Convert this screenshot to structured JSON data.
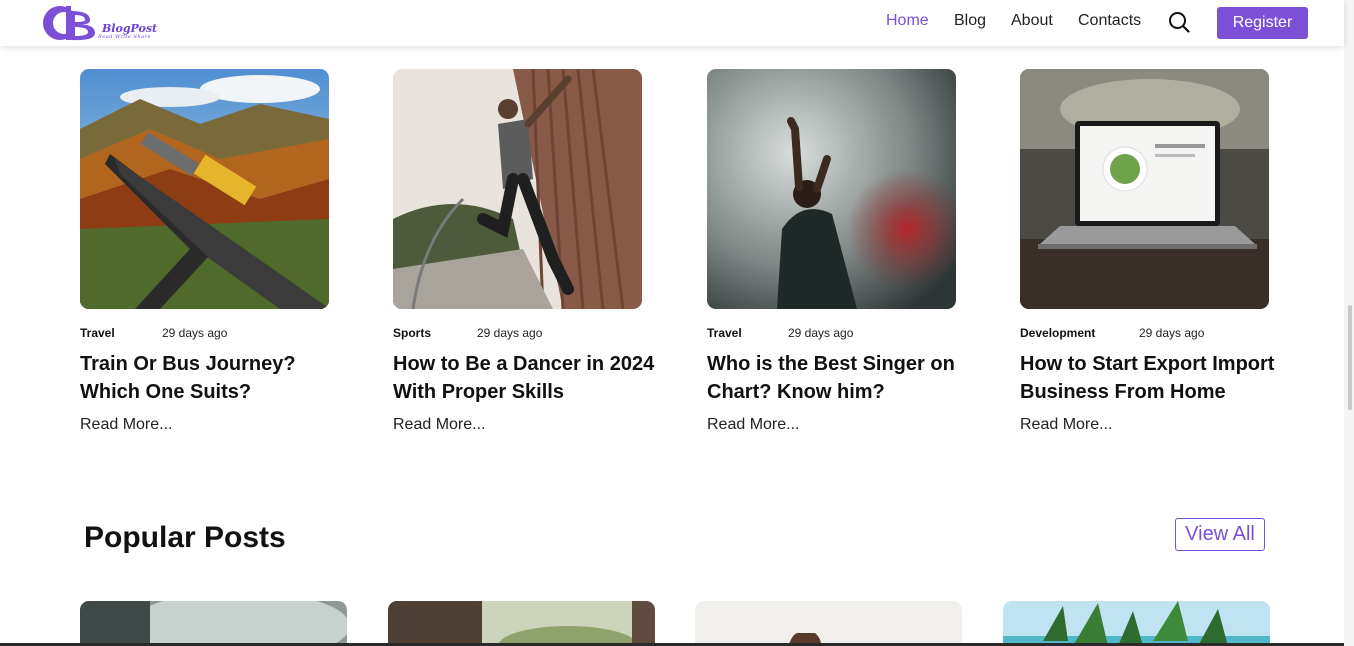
{
  "brand": {
    "name": "BlogPost",
    "tagline": "Read Write Share"
  },
  "nav": {
    "items": [
      {
        "label": "Home",
        "active": true
      },
      {
        "label": "Blog",
        "active": false
      },
      {
        "label": "About",
        "active": false
      },
      {
        "label": "Contacts",
        "active": false
      }
    ],
    "search_icon": "search-icon",
    "register_label": "Register"
  },
  "colors": {
    "accent": "#7b4fd6",
    "text": "#111111"
  },
  "posts": [
    {
      "category": "Travel",
      "date": "29 days ago",
      "title": "Train Or Bus Journey? Which One Suits?",
      "read_more": "Read More...",
      "image": "train-on-bridge-autumn"
    },
    {
      "category": "Sports",
      "date": "29 days ago",
      "title": "How to Be a Dancer in 2024 With Proper Skills",
      "read_more": "Read More...",
      "image": "man-jumping-against-wall"
    },
    {
      "category": "Travel",
      "date": "29 days ago",
      "title": "Who is the Best Singer on Chart? Know him?",
      "read_more": "Read More...",
      "image": "singer-with-smoke"
    },
    {
      "category": "Development",
      "date": "29 days ago",
      "title": "How to Start Export Import Business From Home",
      "read_more": "Read More...",
      "image": "laptop-on-desk"
    }
  ],
  "popular": {
    "title": "Popular Posts",
    "view_all_label": "View All",
    "images": [
      "smoke-scene",
      "blurred-outdoor",
      "person-bright",
      "tropical-beach"
    ]
  }
}
